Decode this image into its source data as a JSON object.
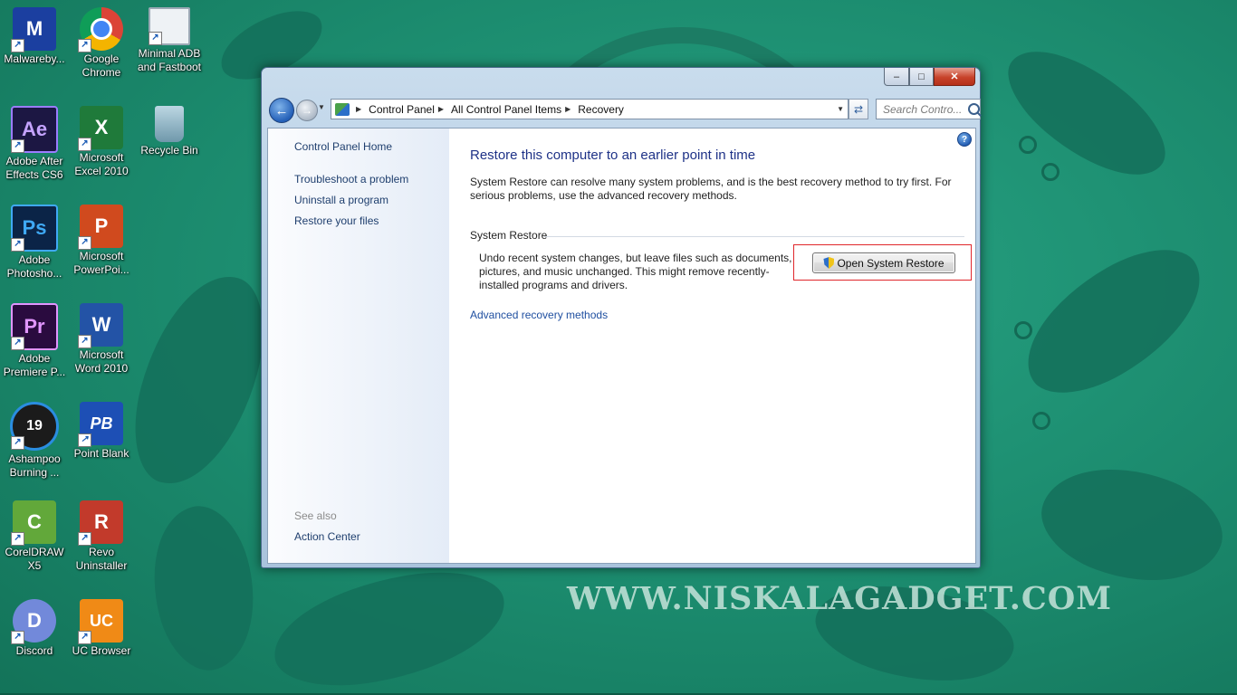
{
  "desktop": {
    "icons": [
      {
        "label": "Malwareby...",
        "color": "#1b3fa0"
      },
      {
        "label": "Google Chrome",
        "color": "#db4437"
      },
      {
        "label": "Minimal ADB and Fastboot",
        "color": "#c9d3dc"
      },
      {
        "label": "Adobe After Effects CS6",
        "color": "#1c1743",
        "glyph": "Ae",
        "glyph_color": "#c4a3ff"
      },
      {
        "label": "Microsoft Excel 2010",
        "color": "#1f7a3a",
        "glyph": "X",
        "glyph_color": "#ffffff"
      },
      {
        "label": "Recycle Bin",
        "color": "#8fb8c9"
      },
      {
        "label": "Adobe Photosho...",
        "color": "#0b2447",
        "glyph": "Ps",
        "glyph_color": "#3fa9f5"
      },
      {
        "label": "Microsoft PowerPoi...",
        "color": "#d04a1e",
        "glyph": "P",
        "glyph_color": "#ffffff"
      },
      {
        "label": "Adobe Premiere P...",
        "color": "#2a0b3f",
        "glyph": "Pr",
        "glyph_color": "#e195ff"
      },
      {
        "label": "Microsoft Word 2010",
        "color": "#2353a6",
        "glyph": "W",
        "glyph_color": "#ffffff"
      },
      {
        "label": "Ashampoo Burning ...",
        "color": "#1b1b1b",
        "glyph": "19",
        "glyph_color": "#ffffff"
      },
      {
        "label": "Point Blank",
        "color": "#1d4fb5",
        "glyph": "PB",
        "glyph_color": "#ffffff"
      },
      {
        "label": "CorelDRAW X5",
        "color": "#62a83a",
        "glyph": "C",
        "glyph_color": "#ffffff"
      },
      {
        "label": "Revo Uninstaller",
        "color": "#c23a2b",
        "glyph": "R",
        "glyph_color": "#ffffff"
      },
      {
        "label": "Discord",
        "color": "#7289da",
        "glyph": "D",
        "glyph_color": "#ffffff"
      },
      {
        "label": "UC Browser",
        "color": "#f08a16",
        "glyph": "UC",
        "glyph_color": "#ffffff"
      }
    ]
  },
  "window": {
    "title_buttons": {
      "minimize": "‒",
      "maximize": "□",
      "close": "✕"
    },
    "breadcrumb": [
      "Control Panel",
      "All Control Panel Items",
      "Recovery"
    ],
    "search_placeholder": "Search Contro...",
    "left_pane": {
      "home": "Control Panel Home",
      "links": [
        "Troubleshoot a problem",
        "Uninstall a program",
        "Restore your files"
      ],
      "see_also_label": "See also",
      "see_also_links": [
        "Action Center"
      ]
    },
    "content": {
      "heading": "Restore this computer to an earlier point in time",
      "description": "System Restore can resolve many system problems, and is the best recovery method to try first. For serious problems, use the advanced recovery methods.",
      "group_title": "System Restore",
      "group_text": "Undo recent system changes, but leave files such as documents, pictures, and music unchanged. This might remove recently-installed programs and drivers.",
      "restore_button": "Open System Restore",
      "advanced_link": "Advanced recovery methods"
    }
  },
  "watermark": "WWW.NISKALAGADGET.COM",
  "colors": {
    "desktop_bg": "#1f8f73",
    "heading": "#1e3287",
    "link": "#1f3f6e",
    "highlight_box": "#e0262b"
  }
}
